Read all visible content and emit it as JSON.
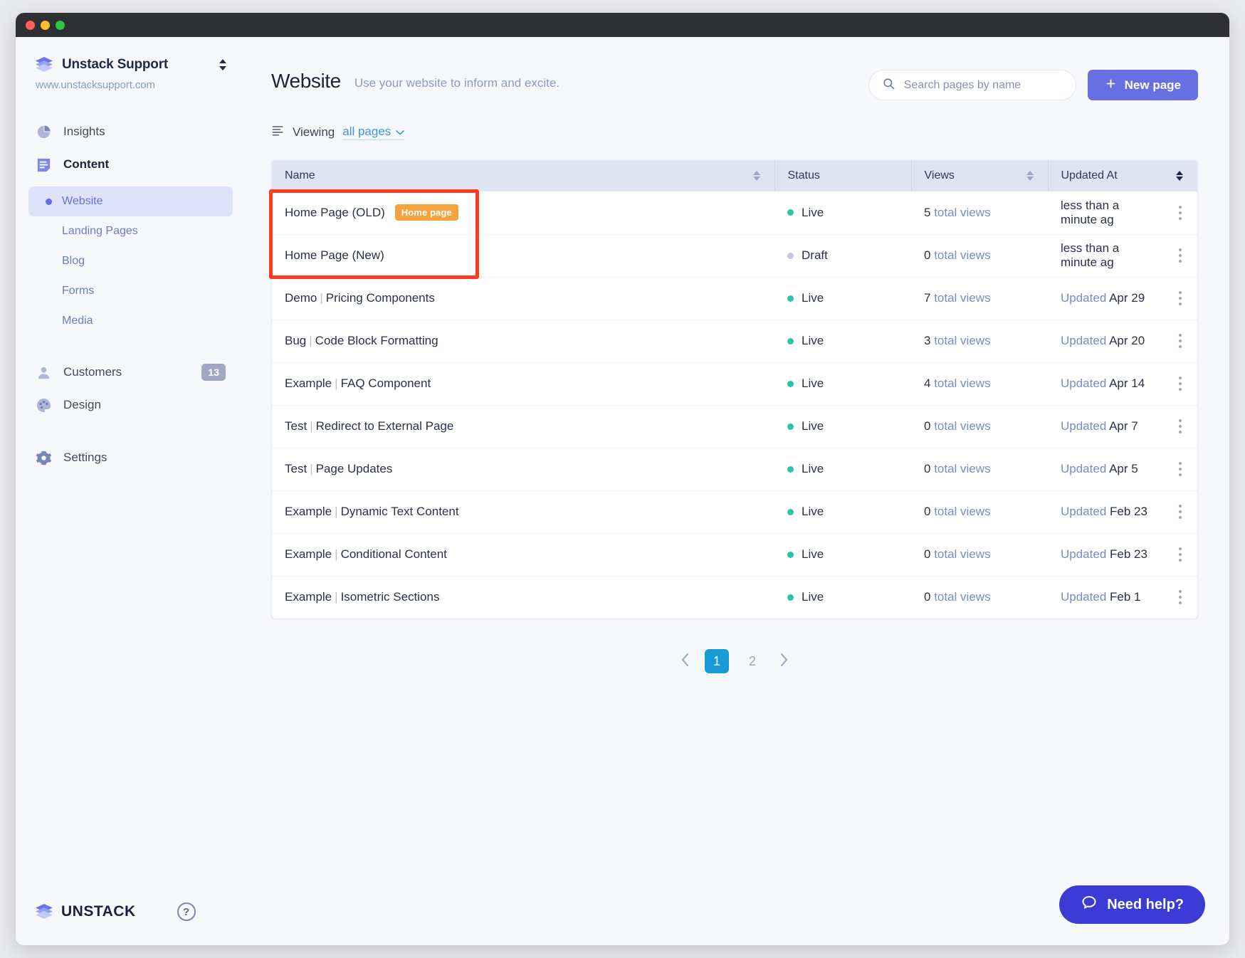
{
  "window": {
    "title_dots": [
      "red",
      "yellow",
      "green"
    ]
  },
  "sidebar": {
    "brand": {
      "name": "Unstack Support",
      "url": "www.unstacksupport.com",
      "icon": "stack-icon",
      "switcher_icon": "chevron-up-down-icon"
    },
    "nav": [
      {
        "label": "Insights",
        "icon": "pie-chart-icon",
        "active": false
      },
      {
        "label": "Content",
        "icon": "content-icon",
        "active": true
      }
    ],
    "content_items": [
      {
        "label": "Website",
        "active": true
      },
      {
        "label": "Landing Pages",
        "active": false
      },
      {
        "label": "Blog",
        "active": false
      },
      {
        "label": "Forms",
        "active": false
      },
      {
        "label": "Media",
        "active": false
      }
    ],
    "lower_nav": [
      {
        "label": "Customers",
        "icon": "person-icon",
        "badge": "13"
      },
      {
        "label": "Design",
        "icon": "palette-icon",
        "badge": ""
      },
      {
        "label": "Settings",
        "icon": "gear-icon",
        "badge": ""
      }
    ],
    "footer": {
      "logo_text": "UNSTACK",
      "help_icon": "question-mark-icon"
    }
  },
  "header": {
    "title": "Website",
    "subtitle": "Use your website to inform and excite.",
    "search": {
      "placeholder": "Search pages by name",
      "value": "",
      "icon": "search-icon"
    },
    "new_page_button": {
      "label": "New page",
      "icon": "plus-icon"
    }
  },
  "filter": {
    "icon": "filter-list-icon",
    "label": "Viewing",
    "value": "all pages",
    "chevron": "chevron-down-icon"
  },
  "table": {
    "columns": [
      {
        "key": "name",
        "label": "Name",
        "sortable": true,
        "sort_active": false
      },
      {
        "key": "status",
        "label": "Status",
        "sortable": false,
        "sort_active": false
      },
      {
        "key": "views",
        "label": "Views",
        "sortable": true,
        "sort_active": false
      },
      {
        "key": "updated",
        "label": "Updated At",
        "sortable": true,
        "sort_active": true
      }
    ],
    "rows": [
      {
        "prefix": "",
        "name": "Home Page (OLD)",
        "pill": "Home page",
        "status": "Live",
        "status_type": "live",
        "views_num": "5",
        "views_label": "total views",
        "updated_prefix": "",
        "updated_value": "less than a minute ag"
      },
      {
        "prefix": "",
        "name": "Home Page (New)",
        "pill": "",
        "status": "Draft",
        "status_type": "draft",
        "views_num": "0",
        "views_label": "total views",
        "updated_prefix": "",
        "updated_value": "less than a minute ag"
      },
      {
        "prefix": "Demo",
        "name": "Pricing Components",
        "pill": "",
        "status": "Live",
        "status_type": "live",
        "views_num": "7",
        "views_label": "total views",
        "updated_prefix": "Updated",
        "updated_value": "Apr 29"
      },
      {
        "prefix": "Bug",
        "name": "Code Block Formatting",
        "pill": "",
        "status": "Live",
        "status_type": "live",
        "views_num": "3",
        "views_label": "total views",
        "updated_prefix": "Updated",
        "updated_value": "Apr 20"
      },
      {
        "prefix": "Example",
        "name": "FAQ Component",
        "pill": "",
        "status": "Live",
        "status_type": "live",
        "views_num": "4",
        "views_label": "total views",
        "updated_prefix": "Updated",
        "updated_value": "Apr 14"
      },
      {
        "prefix": "Test",
        "name": "Redirect to External Page",
        "pill": "",
        "status": "Live",
        "status_type": "live",
        "views_num": "0",
        "views_label": "total views",
        "updated_prefix": "Updated",
        "updated_value": "Apr 7"
      },
      {
        "prefix": "Test",
        "name": "Page Updates",
        "pill": "",
        "status": "Live",
        "status_type": "live",
        "views_num": "0",
        "views_label": "total views",
        "updated_prefix": "Updated",
        "updated_value": "Apr 5"
      },
      {
        "prefix": "Example",
        "name": "Dynamic Text Content",
        "pill": "",
        "status": "Live",
        "status_type": "live",
        "views_num": "0",
        "views_label": "total views",
        "updated_prefix": "Updated",
        "updated_value": "Feb 23"
      },
      {
        "prefix": "Example",
        "name": "Conditional Content",
        "pill": "",
        "status": "Live",
        "status_type": "live",
        "views_num": "0",
        "views_label": "total views",
        "updated_prefix": "Updated",
        "updated_value": "Feb 23"
      },
      {
        "prefix": "Example",
        "name": "Isometric Sections",
        "pill": "",
        "status": "Live",
        "status_type": "live",
        "views_num": "0",
        "views_label": "total views",
        "updated_prefix": "Updated",
        "updated_value": "Feb 1"
      }
    ]
  },
  "pagination": {
    "prev_icon": "chevron-left-icon",
    "next_icon": "chevron-right-icon",
    "pages": [
      "1",
      "2"
    ],
    "current": "1"
  },
  "need_help": {
    "label": "Need help?",
    "icon": "chat-bubble-icon"
  },
  "annotation": {
    "type": "red-rectangle-highlight",
    "target": "first-two-rows-name-cells"
  },
  "colors": {
    "accent_purple": "#6670e0",
    "link_blue": "#3a9ad9",
    "pagination_active": "#199bd7",
    "status_live": "#2ec3a6",
    "status_draft": "#c2c8d6",
    "pill_orange": "#f5a33c",
    "highlight_red": "#ff3b21",
    "need_help_blue": "#3d3bd6"
  }
}
